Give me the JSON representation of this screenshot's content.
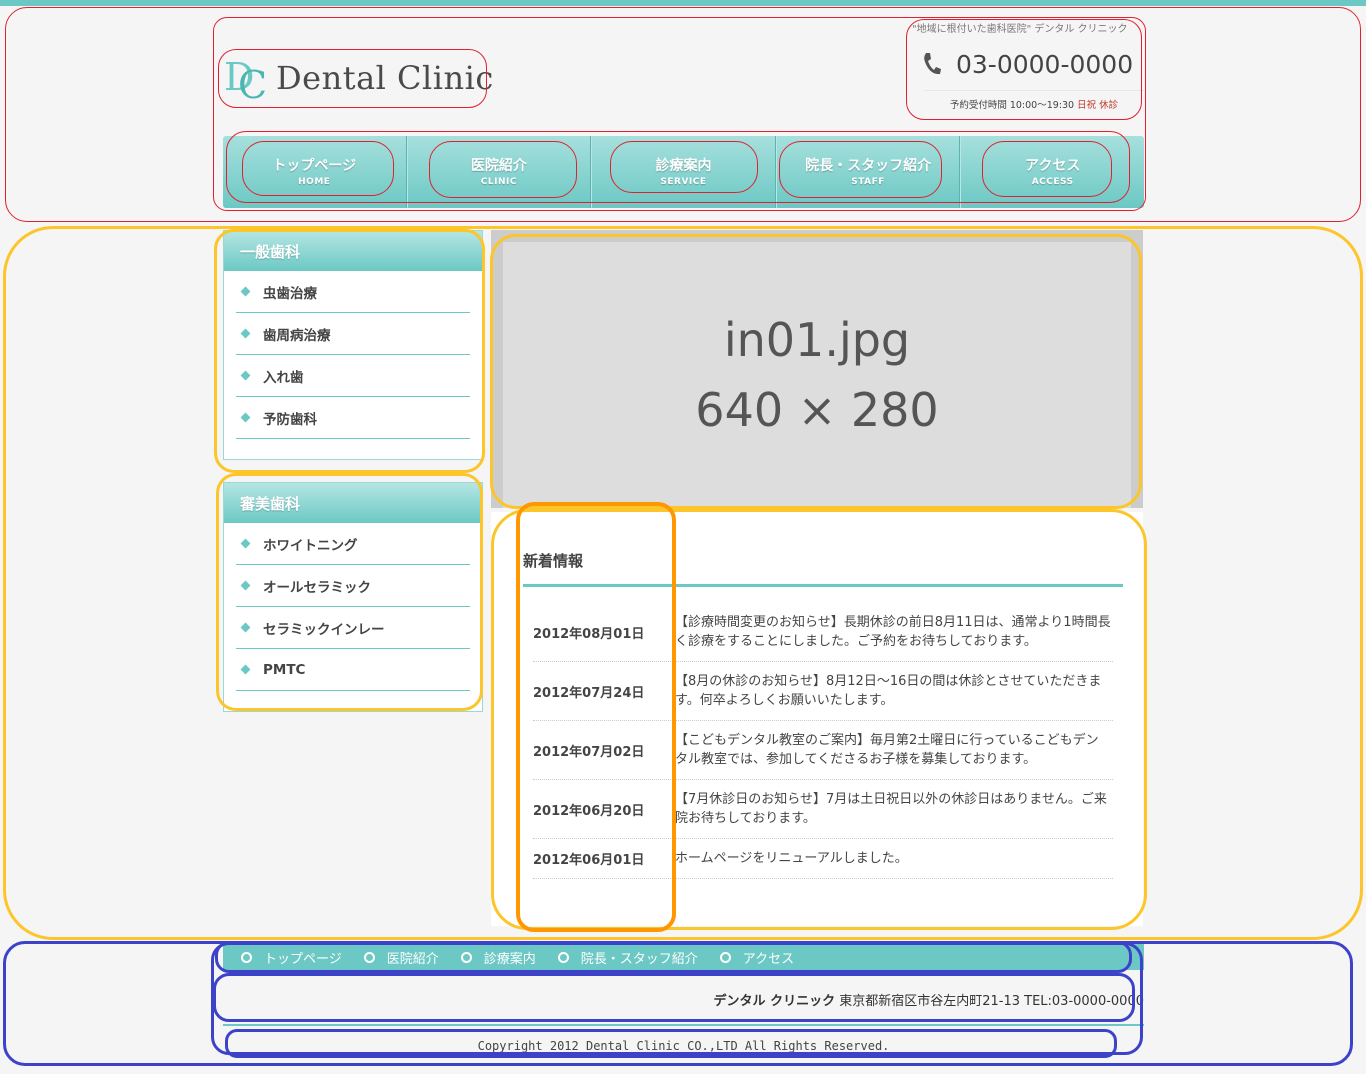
{
  "colors": {
    "accent": "#6cc8c4",
    "alert": "#c0392b",
    "annotation_header": "#e02030",
    "annotation_content": "#fcc52a",
    "annotation_dates": "#ff9800",
    "annotation_footer": "#3c43c8"
  },
  "header": {
    "logo_mark": {
      "d": "D",
      "c": "C"
    },
    "logo_text": "Dental Clinic",
    "tagline": "\"地域に根付いた歯科医院\" デンタル クリニック",
    "phone_icon": "phone-icon",
    "phone": "03-0000-0000",
    "hours_label": "予約受付時間 10:00～19:30",
    "closed": "日祝 休診"
  },
  "global_nav": [
    {
      "jp": "トップページ",
      "en": "HOME"
    },
    {
      "jp": "医院紹介",
      "en": "CLINIC"
    },
    {
      "jp": "診療案内",
      "en": "SERVICE"
    },
    {
      "jp": "院長・スタッフ紹介",
      "en": "STAFF"
    },
    {
      "jp": "アクセス",
      "en": "ACCESS"
    }
  ],
  "sidebar": {
    "general": {
      "title": "一般歯科",
      "items": [
        "虫歯治療",
        "歯周病治療",
        "入れ歯",
        "予防歯科"
      ]
    },
    "cosmetic": {
      "title": "審美歯科",
      "items": [
        "ホワイトニング",
        "オールセラミック",
        "セラミックインレー",
        "PMTC"
      ]
    }
  },
  "main_image": {
    "line1": "in01.jpg",
    "line2": "640 × 280"
  },
  "news": {
    "title": "新着情報",
    "items": [
      {
        "date": "2012年08月01日",
        "text": "【診療時間変更のお知らせ】長期休診の前日8月11日は、通常より1時間長く診療をすることにしました。ご予約をお待ちしております。"
      },
      {
        "date": "2012年07月24日",
        "text": "【8月の休診のお知らせ】8月12日～16日の間は休診とさせていただきます。何卒よろしくお願いいたします。"
      },
      {
        "date": "2012年07月02日",
        "text": "【こどもデンタル教室のご案内】毎月第2土曜日に行っているこどもデンタル教室では、参加してくださるお子様を募集しております。"
      },
      {
        "date": "2012年06月20日",
        "text": "【7月休診日のお知らせ】7月は土日祝日以外の休診日はありません。ご来院お待ちしております。"
      },
      {
        "date": "2012年06月01日",
        "text": "ホームページをリニューアルしました。"
      }
    ]
  },
  "footer": {
    "nav": [
      "トップページ",
      "医院紹介",
      "診療案内",
      "院長・スタッフ紹介",
      "アクセス"
    ],
    "clinic_name": "デンタル クリニック",
    "address": "東京都新宿区市谷左内町21-13 TEL:03-0000-0000",
    "copyright": "Copyright 2012 Dental Clinic CO.,LTD All Rights Reserved."
  }
}
